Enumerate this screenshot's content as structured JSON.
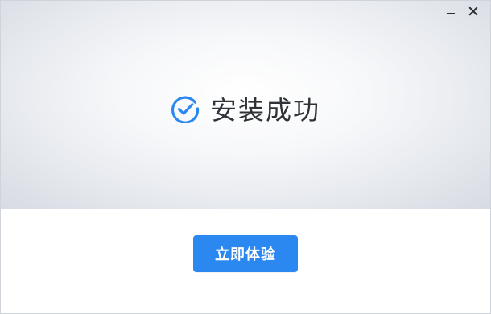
{
  "window": {
    "controls": {
      "minimize_icon": "minimize-icon",
      "close_icon": "close-icon"
    }
  },
  "status": {
    "icon": "check-circle-icon",
    "text": "安装成功",
    "accent_color": "#2b88f0"
  },
  "actions": {
    "primary_label": "立即体验",
    "primary_color": "#2b88f0"
  }
}
